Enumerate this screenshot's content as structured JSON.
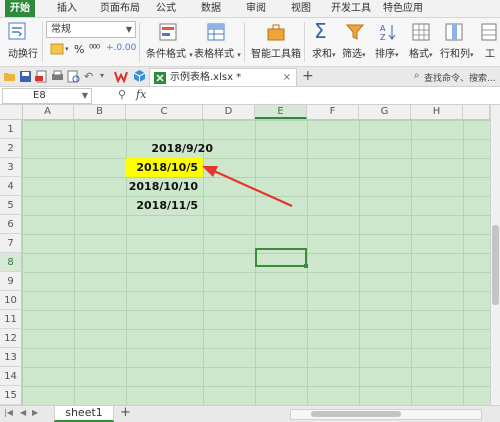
{
  "menu": {
    "tabs": [
      "开始",
      "插入",
      "页面布局",
      "公式",
      "数据",
      "审阅",
      "视图",
      "开发工具",
      "特色应用"
    ],
    "active_index": 0
  },
  "ribbon": {
    "wrap_text_label": "动换行",
    "number_format": "常规",
    "percent_symbol": "%",
    "conditional_format_label": "条件格式",
    "table_style_label": "表格样式",
    "smart_toolbox_label": "智能工具箱",
    "sum_label": "求和",
    "filter_label": "筛选",
    "sort_label": "排序",
    "format_label": "格式",
    "row_col_label": "行和列",
    "worksheet_label": "工"
  },
  "tabbar": {
    "file_name": "示例表格.xlsx *",
    "close_symbol": "×",
    "add_symbol": "+",
    "search_text": "查找命令、搜索..."
  },
  "formula": {
    "cell_ref": "E8",
    "fx": "fx"
  },
  "grid": {
    "columns": [
      "A",
      "B",
      "C",
      "D",
      "E",
      "F",
      "G",
      "H"
    ],
    "selected_column": "E",
    "rows": [
      "1",
      "2",
      "3",
      "4",
      "5",
      "6",
      "7",
      "8",
      "9",
      "10",
      "11",
      "12",
      "13",
      "14",
      "15"
    ],
    "selected_row": "8",
    "dates": [
      "2018/9/20",
      "2018/10/5",
      "2018/10/10",
      "2018/11/5"
    ],
    "highlight_color": "#ffff00",
    "annotation_color": "#e8342c"
  },
  "sheets": {
    "tabs": [
      "sheet1"
    ],
    "add_symbol": "+"
  }
}
